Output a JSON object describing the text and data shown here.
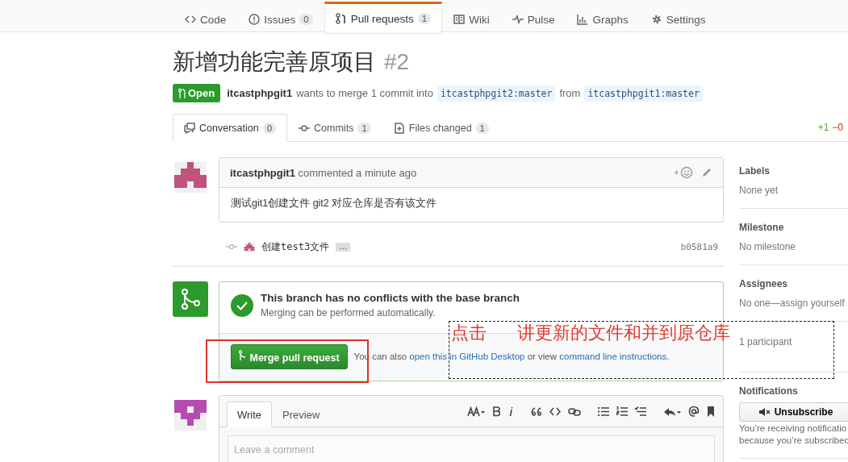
{
  "repo_nav": [
    {
      "label": "Code",
      "selected": false
    },
    {
      "label": "Issues",
      "count": "0",
      "selected": false
    },
    {
      "label": "Pull requests",
      "count": "1",
      "selected": true
    },
    {
      "label": "Wiki",
      "selected": false
    },
    {
      "label": "Pulse",
      "selected": false
    },
    {
      "label": "Graphs",
      "selected": false
    },
    {
      "label": "Settings",
      "selected": false
    }
  ],
  "title": "新增功能完善原项目",
  "number": "#2",
  "state": "Open",
  "author": "itcastphpgit1",
  "merge_text": "wants to merge 1 commit into",
  "base": "itcastphpgit2:master",
  "from": "from",
  "head": "itcastphpgit1:master",
  "pr_tabs": [
    {
      "label": "Conversation",
      "count": "0",
      "selected": true
    },
    {
      "label": "Commits",
      "count": "1",
      "selected": false
    },
    {
      "label": "Files changed",
      "count": "1",
      "selected": false
    }
  ],
  "diffstat": {
    "added": "+1",
    "removed": "−0"
  },
  "comment": {
    "author": "itcastphpgit1",
    "action": "commented a minute ago",
    "body": "测试git1创建文件 git2 对应仓库是否有该文件"
  },
  "commit": {
    "message": "创建test3文件",
    "more": "…",
    "sha": "b0581a9"
  },
  "merge": {
    "title": "This branch has no conflicts with the base branch",
    "subtitle": "Merging can be performed automatically.",
    "button": "Merge pull request",
    "note_start": "You can also",
    "link1": "open this in GitHub Desktop",
    "note_mid": "or view",
    "link2": "command line instructions",
    "note_end": "."
  },
  "form": {
    "tabs": [
      {
        "label": "Write",
        "selected": true
      },
      {
        "label": "Preview",
        "selected": false
      }
    ],
    "placeholder": "Leave a comment"
  },
  "sidebar": [
    {
      "heading": "Labels",
      "value": "None yet"
    },
    {
      "heading": "Milestone",
      "value": "No milestone"
    },
    {
      "heading": "Assignees",
      "value": "No one—assign yourself"
    },
    {
      "value": "1 participant"
    },
    {
      "heading": "Notifications",
      "button": "Unsubscribe",
      "lines": [
        "You’re receiving notificatio",
        "because you’re subscribed"
      ]
    }
  ],
  "annotation": {
    "action": "点击",
    "description": "讲更新的文件和并到原仓库"
  }
}
